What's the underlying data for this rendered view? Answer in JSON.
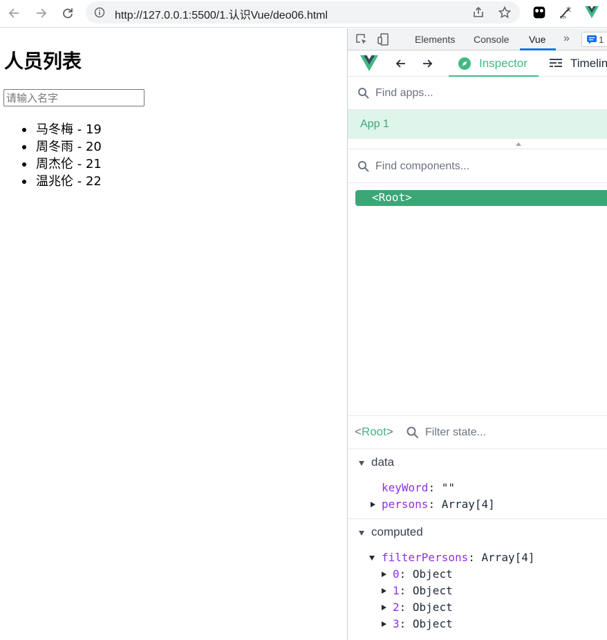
{
  "browser": {
    "url": "http://127.0.0.1:5500/1.认识Vue/deo06.html"
  },
  "page": {
    "title": "人员列表",
    "search_placeholder": "请输入名字",
    "persons": [
      "马冬梅 - 19",
      "周冬雨 - 20",
      "周杰伦 - 21",
      "温兆伦 - 22"
    ]
  },
  "devtools": {
    "tabs": [
      "Elements",
      "Console",
      "Vue"
    ],
    "more": "»",
    "issues_count": "1",
    "vue": {
      "inspector_label": "Inspector",
      "timeline_label": "Timeline",
      "find_apps_placeholder": "Find apps...",
      "app_name": "App 1",
      "find_components_placeholder": "Find components...",
      "root_node": "<Root>",
      "selected_component": "Root",
      "filter_state_placeholder": "Filter state...",
      "data_section": "data",
      "data": {
        "keyword_key": "keyWord",
        "keyword_value": "\"\"",
        "persons_key": "persons",
        "persons_value": "Array[4]"
      },
      "computed_section": "computed",
      "computed": {
        "key": "filterPersons",
        "value": "Array[4]",
        "items": [
          {
            "index": "0",
            "value": "Object"
          },
          {
            "index": "1",
            "value": "Object"
          },
          {
            "index": "2",
            "value": "Object"
          },
          {
            "index": "3",
            "value": "Object"
          }
        ]
      }
    }
  },
  "colors": {
    "vue_green": "#42b883",
    "root_bg": "#3ba776",
    "app_row_bg": "#dff5eb",
    "key_purple": "#8e2fe6"
  }
}
